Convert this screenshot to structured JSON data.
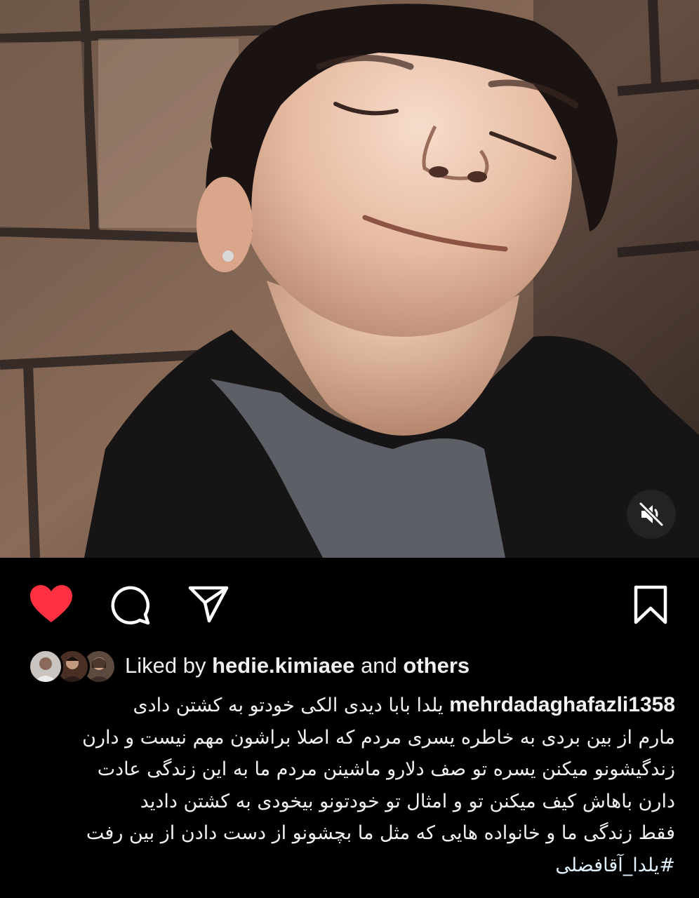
{
  "post": {
    "media": {
      "alt_icon": "person-smiling-photo",
      "mute_icon": "speaker-muted-icon"
    },
    "actions": {
      "like_icon": "heart-icon",
      "comment_icon": "comment-icon",
      "share_icon": "paper-plane-icon",
      "save_icon": "bookmark-icon",
      "liked": true,
      "like_color": "#ff3040"
    },
    "likes": {
      "prefix": "Liked by",
      "user": "hedie.kimiaee",
      "and": "and",
      "others": "others"
    },
    "caption": {
      "username": "mehrdadaghafazli1358",
      "line1": "یلدا بابا دیدی الکی خودتو به کشتن دادی",
      "line2": "مارم از بین بردی به خاطره یسری مردم که اصلا براشون مهم نیست و دارن",
      "line3": "زندگیشونو میکنن یسره تو صف  دلارو ماشینن مردم ما به این زندگی عادت",
      "line4": "دارن باهاش کیف میکنن تو و امثال تو خودتونو بیخودی به کشتن دادید",
      "line5": "فقط زندگی ما و خانواده هایی که مثل ما بچشونو از دست دادن از بین رفت",
      "hashtag": "#یلدا_آقافضلی"
    }
  },
  "colors": {
    "background": "#000000",
    "text": "#f2f2f2",
    "like": "#ff3040",
    "hashtag": "#e0f1ff"
  }
}
